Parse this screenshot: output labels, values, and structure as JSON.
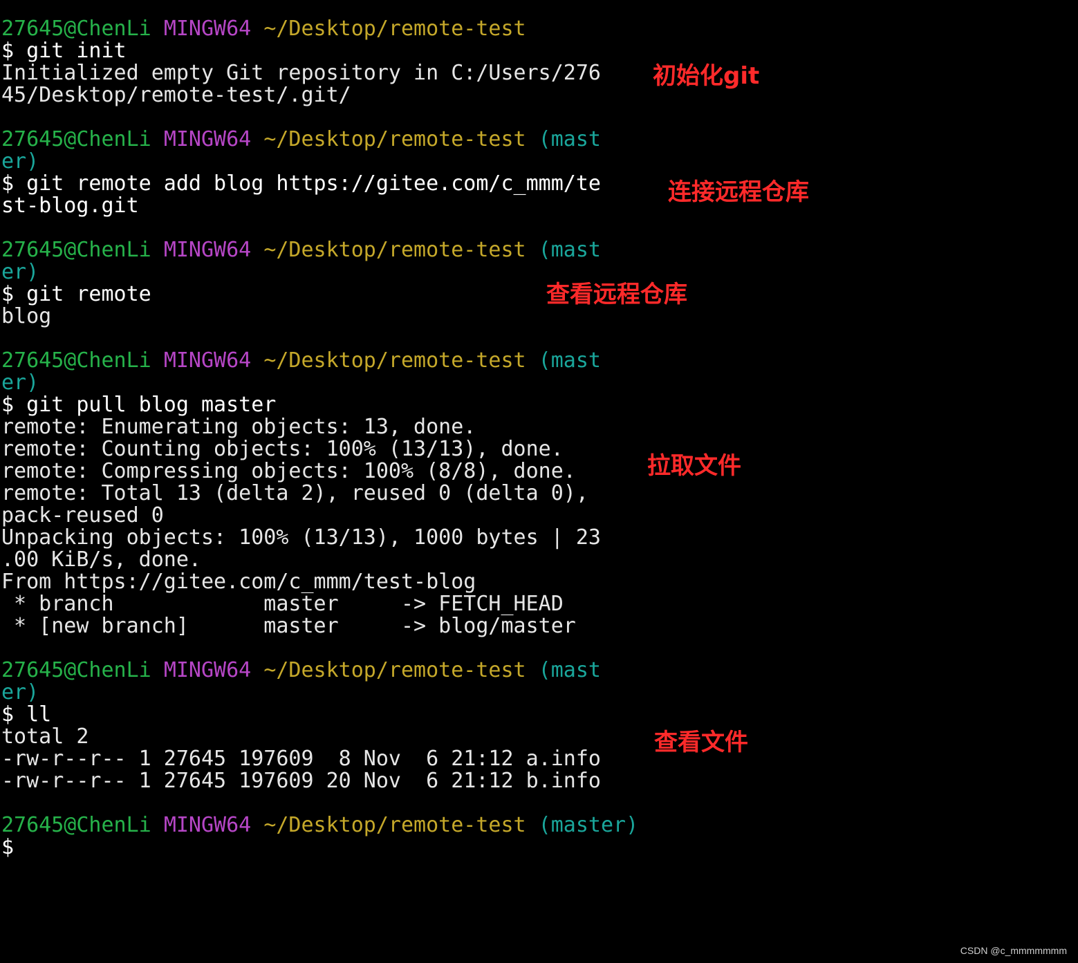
{
  "colors": {
    "background": "#000000",
    "user": "#26b24a",
    "host": "#b646c6",
    "path": "#c5a82a",
    "branch": "#1aa69b",
    "output": "#e6e6e6",
    "annotation": "#ff2a2a"
  },
  "prompt": {
    "user": "27645@ChenLi",
    "host": "MINGW64",
    "path": "~/Desktop/remote-test",
    "branch_part1": "(mast",
    "branch_part2": "er)",
    "branch_full": "(master)",
    "symbol": "$"
  },
  "commands": {
    "init": "git init",
    "remote_add_1": "git remote add blog https://gitee.com/c_mmm/te",
    "remote_add_2": "st-blog.git",
    "remote": "git remote",
    "pull": "git pull blog master",
    "ll": "ll"
  },
  "output": {
    "init_1": "Initialized empty Git repository in C:/Users/276",
    "init_2": "45/Desktop/remote-test/.git/",
    "remote_list": "blog",
    "pull": [
      "remote: Enumerating objects: 13, done.",
      "remote: Counting objects: 100% (13/13), done.",
      "remote: Compressing objects: 100% (8/8), done.",
      "remote: Total 13 (delta 2), reused 0 (delta 0),",
      "pack-reused 0",
      "Unpacking objects: 100% (13/13), 1000 bytes | 23",
      ".00 KiB/s, done.",
      "From https://gitee.com/c_mmm/test-blog",
      " * branch            master     -> FETCH_HEAD",
      " * [new branch]      master     -> blog/master"
    ],
    "ll": [
      "total 2",
      "-rw-r--r-- 1 27645 197609  8 Nov  6 21:12 a.info",
      "-rw-r--r-- 1 27645 197609 20 Nov  6 21:12 b.info"
    ]
  },
  "annotations": {
    "init": "初始化git",
    "connect": "连接远程仓库",
    "view_remote": "查看远程仓库",
    "pull": "拉取文件",
    "view_files": "查看文件"
  },
  "watermark": "CSDN @c_mmmmmmm"
}
